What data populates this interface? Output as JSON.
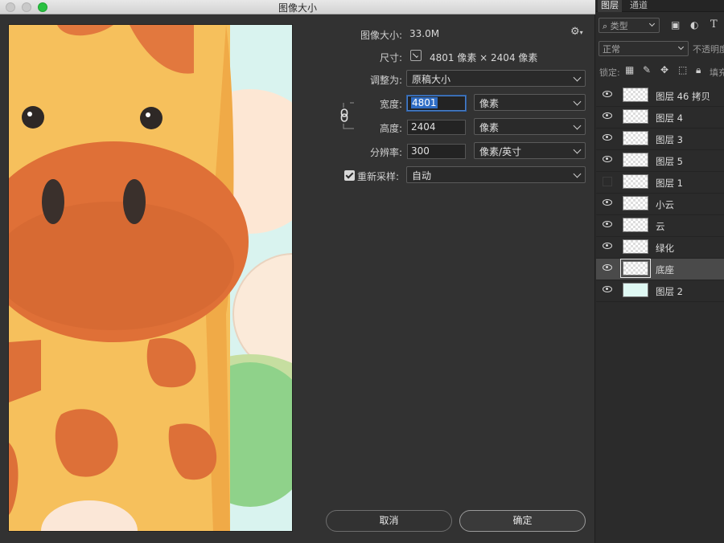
{
  "window": {
    "title": "图像大小"
  },
  "form": {
    "size_label": "图像大小:",
    "size_value": "33.0M",
    "dimensions_label": "尺寸:",
    "dimensions_value": "4801 像素  ×  2404 像素",
    "fit_label": "调整为:",
    "fit_value": "原稿大小",
    "width_label": "宽度:",
    "width_value": "4801",
    "width_unit": "像素",
    "height_label": "高度:",
    "height_value": "2404",
    "height_unit": "像素",
    "resolution_label": "分辨率:",
    "resolution_value": "300",
    "resolution_unit": "像素/英寸",
    "resample_label": "重新采样:",
    "resample_value": "自动",
    "resample_checked": true
  },
  "buttons": {
    "cancel": "取消",
    "ok": "确定"
  },
  "panel": {
    "tabs": [
      {
        "label": "图层",
        "active": true
      },
      {
        "label": "通道",
        "active": false
      }
    ],
    "filter_value": "类型",
    "blend_mode": "正常",
    "opacity_label": "不透明度",
    "lock_label": "锁定:",
    "fill_label": "填充",
    "layers": [
      {
        "name": "图层 46 拷贝",
        "visible": true,
        "thumb": "transparent"
      },
      {
        "name": "图层 4",
        "visible": true,
        "thumb": "transparent"
      },
      {
        "name": "图层 3",
        "visible": true,
        "thumb": "transparent"
      },
      {
        "name": "图层 5",
        "visible": true,
        "thumb": "transparent"
      },
      {
        "name": "图层 1",
        "visible": false,
        "thumb": "transparent"
      },
      {
        "name": "小云",
        "visible": true,
        "thumb": "transparent"
      },
      {
        "name": "云",
        "visible": true,
        "thumb": "transparent"
      },
      {
        "name": "绿化",
        "visible": true,
        "thumb": "transparent"
      },
      {
        "name": "底座",
        "visible": true,
        "thumb": "transparent",
        "selected": true
      },
      {
        "name": "图层 2",
        "visible": true,
        "thumb": "mint"
      }
    ]
  },
  "colors": {
    "accent": "#2f6dc5",
    "giraffe_body": "#f6c05c",
    "giraffe_spot": "#dd7038",
    "sky": "#d9f3ef"
  }
}
